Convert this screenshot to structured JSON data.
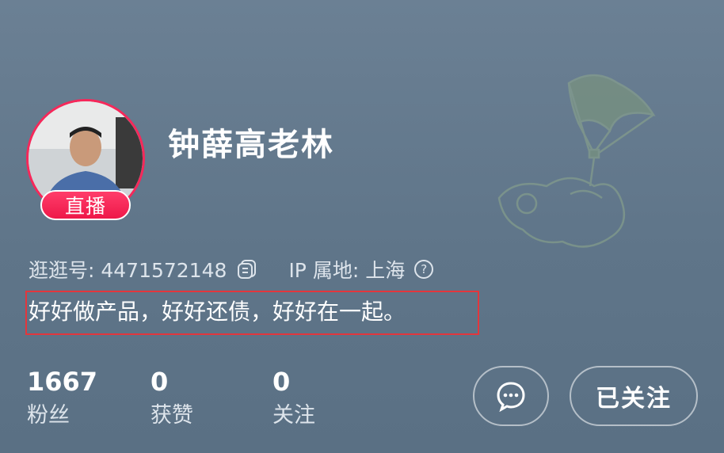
{
  "profile": {
    "username": "钟薛高老林",
    "live_badge": "直播",
    "id_label": "逛逛号: 4471572148",
    "ip_label": "IP 属地: 上海",
    "help_glyph": "?",
    "bio": "好好做产品，好好还债，好好在一起。"
  },
  "stats": [
    {
      "value": "1667",
      "label": "粉丝"
    },
    {
      "value": "0",
      "label": "获赞"
    },
    {
      "value": "0",
      "label": "关注"
    }
  ],
  "actions": {
    "follow_label": "已关注",
    "message_icon": "chat-bubble-icon"
  },
  "colors": {
    "background": "#6b8094",
    "accent": "#f6285a",
    "highlight_box": "#e3363c"
  }
}
